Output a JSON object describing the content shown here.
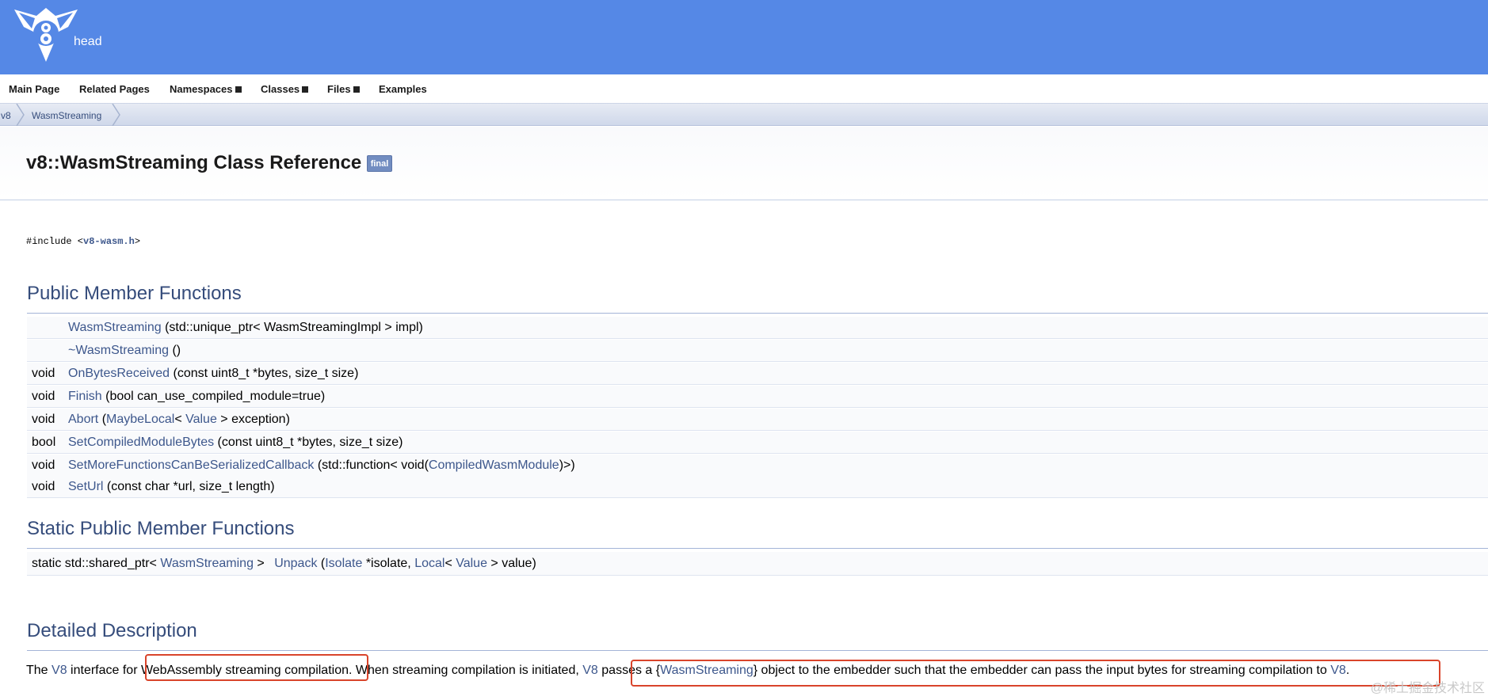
{
  "header": {
    "project_name": "head"
  },
  "nav": {
    "items": [
      {
        "label": "Main Page",
        "dropdown": false
      },
      {
        "label": "Related Pages",
        "dropdown": false
      },
      {
        "label": "Namespaces",
        "dropdown": true
      },
      {
        "label": "Classes",
        "dropdown": true
      },
      {
        "label": "Files",
        "dropdown": true
      },
      {
        "label": "Examples",
        "dropdown": false
      }
    ]
  },
  "breadcrumb": [
    "v8",
    "WasmStreaming"
  ],
  "title": {
    "text": "v8::WasmStreaming Class Reference",
    "badge": "final"
  },
  "include": {
    "prefix": "#include <",
    "file": "v8-wasm.h",
    "suffix": ">"
  },
  "public_member_functions": {
    "heading": "Public Member Functions",
    "rows": [
      {
        "type": "",
        "name": "WasmStreaming",
        "args": " (std::unique_ptr< WasmStreamingImpl > impl)"
      },
      {
        "type": "",
        "name": "~WasmStreaming",
        "args": " ()"
      },
      {
        "type": "void",
        "name": "OnBytesReceived",
        "args": " (const uint8_t *bytes, size_t size)"
      },
      {
        "type": "void",
        "name": "Finish",
        "args": " (bool can_use_compiled_module=true)"
      },
      {
        "type": "void",
        "name": "Abort",
        "args_parts": [
          " (",
          "MaybeLocal",
          "< ",
          "Value",
          " > exception)"
        ]
      },
      {
        "type": "bool",
        "name": "SetCompiledModuleBytes",
        "args": " (const uint8_t *bytes, size_t size)"
      },
      {
        "type": "void",
        "name": "SetMoreFunctionsCanBeSerializedCallback",
        "args_parts": [
          " (std::function< void(",
          "CompiledWasmModule",
          ")>)"
        ]
      },
      {
        "type": "void",
        "name": "SetUrl",
        "args": " (const char *url, size_t length)"
      }
    ]
  },
  "static_public_member_functions": {
    "heading": "Static Public Member Functions",
    "row": {
      "ret_prefix": "static std::shared_ptr< ",
      "ret_type": "WasmStreaming",
      "ret_suffix": " > ",
      "name": "Unpack",
      "p1": " (",
      "isolate": "Isolate",
      "p2": " *isolate, ",
      "local": "Local",
      "p3": "< ",
      "value": "Value",
      "p4": " > value)"
    }
  },
  "detailed_description": {
    "heading": "Detailed Description",
    "t1": "The ",
    "v8_a": "V8",
    "t2": " interface for ",
    "highlight1": "WebAssembly streaming compilation",
    "t3": ". When streaming compilation is initiated, ",
    "v8_b": "V8",
    "t4": " passes a {",
    "wasm": "WasmStreaming",
    "t5": "} object to the embedder such that the embedder can pass the input bytes for streaming compilation to ",
    "v8_c": "V8",
    "t6": "."
  },
  "watermark": "@稀土掘金技术社区",
  "colors": {
    "banner": "#5588e6",
    "link": "#3d578c",
    "heading": "#354c7b",
    "highlight_box": "#d9442b"
  }
}
